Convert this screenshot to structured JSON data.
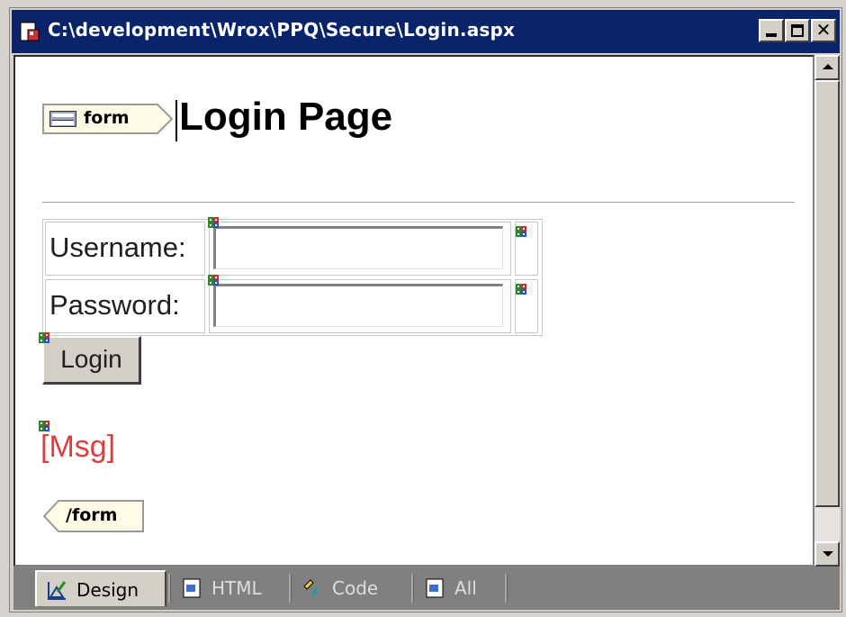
{
  "window": {
    "title": "C:\\development\\Wrox\\PPQ\\Secure\\Login.aspx",
    "colors": {
      "titlebar": "#0a246a",
      "chrome": "#d4d0c8",
      "message": "#e03c3c"
    }
  },
  "editor": {
    "form_tag_open": "form",
    "heading": "Login Page",
    "username_label": "Username:",
    "username_value": "",
    "password_label": "Password:",
    "password_value": "",
    "login_button": "Login",
    "message_label": "[Msg]",
    "form_tag_close": "/form"
  },
  "view_tabs": [
    {
      "label": "Design",
      "icon": "design-icon",
      "active": true
    },
    {
      "label": "HTML",
      "icon": "html-icon",
      "active": false
    },
    {
      "label": "Code",
      "icon": "code-icon",
      "active": false
    },
    {
      "label": "All",
      "icon": "all-icon",
      "active": false
    }
  ]
}
